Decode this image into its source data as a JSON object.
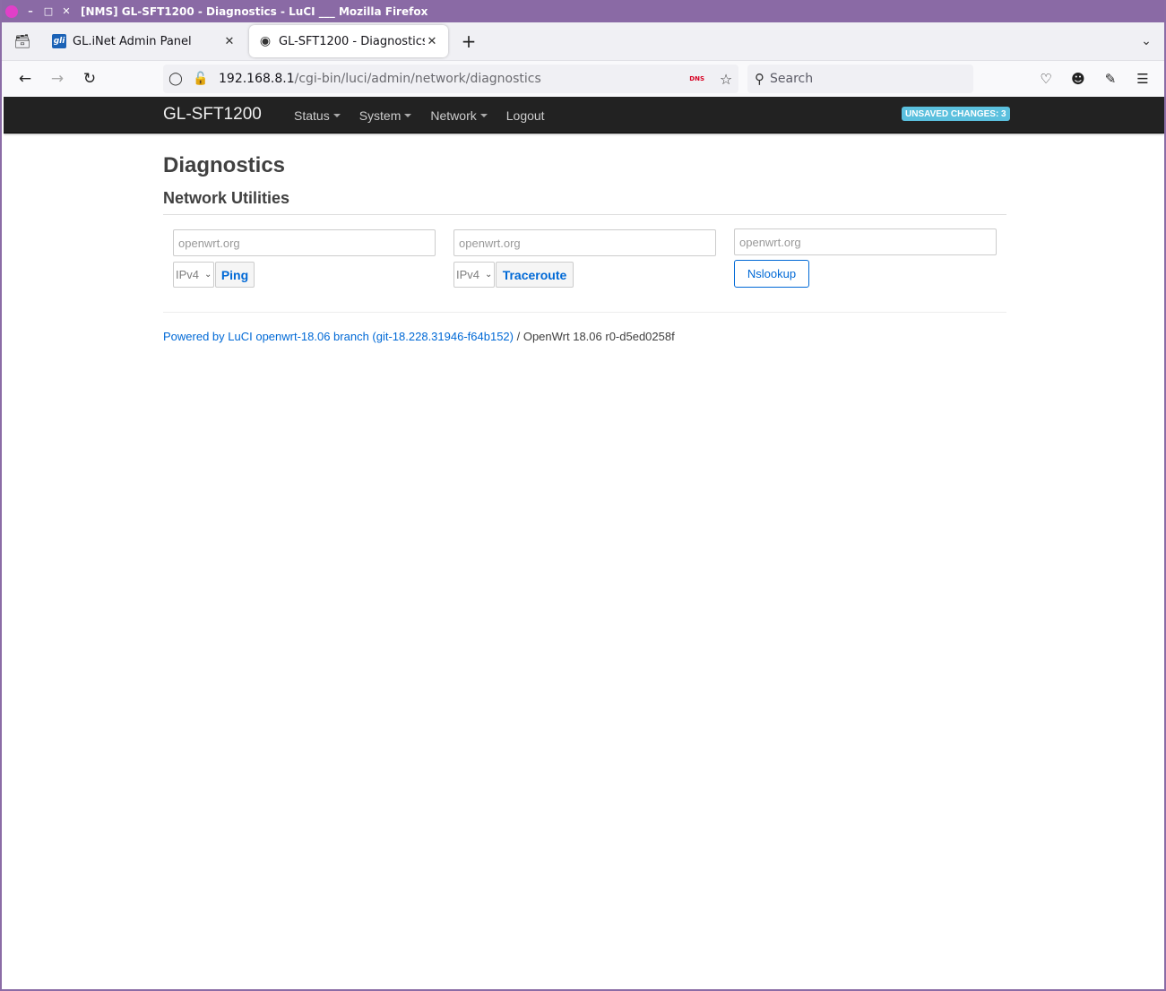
{
  "window": {
    "title": "[NMS] GL-SFT1200 - Diagnostics - LuCI ___ Mozilla Firefox"
  },
  "tabs": [
    {
      "label": "GL.iNet Admin Panel",
      "favicon": "gli"
    },
    {
      "label": "GL-SFT1200 - Diagnostics -",
      "favicon": "luci"
    }
  ],
  "address_bar": {
    "host": "192.168.8.1",
    "path": "/cgi-bin/luci/admin/network/diagnostics",
    "dns_badge": "DNS"
  },
  "search": {
    "placeholder": "Search"
  },
  "header": {
    "brand": "GL-SFT1200",
    "menu": [
      "Status",
      "System",
      "Network",
      "Logout"
    ],
    "unsaved_badge": "UNSAVED CHANGES: 3"
  },
  "main": {
    "title": "Diagnostics",
    "section_title": "Network Utilities",
    "ping": {
      "input_value": "openwrt.org",
      "protocol": "IPv4",
      "button": "Ping"
    },
    "traceroute": {
      "input_value": "openwrt.org",
      "protocol": "IPv4",
      "button": "Traceroute"
    },
    "nslookup": {
      "input_value": "openwrt.org",
      "button": "Nslookup"
    }
  },
  "footer": {
    "link_text": "Powered by LuCI openwrt-18.06 branch (git-18.228.31946-f64b152)",
    "separator": " / ",
    "version": "OpenWrt 18.06 r0-d5ed0258f"
  },
  "colors": {
    "titlebar": "#8a6aa5",
    "header_bg": "#222222",
    "link": "#0069d6",
    "badge": "#5bc0de"
  }
}
